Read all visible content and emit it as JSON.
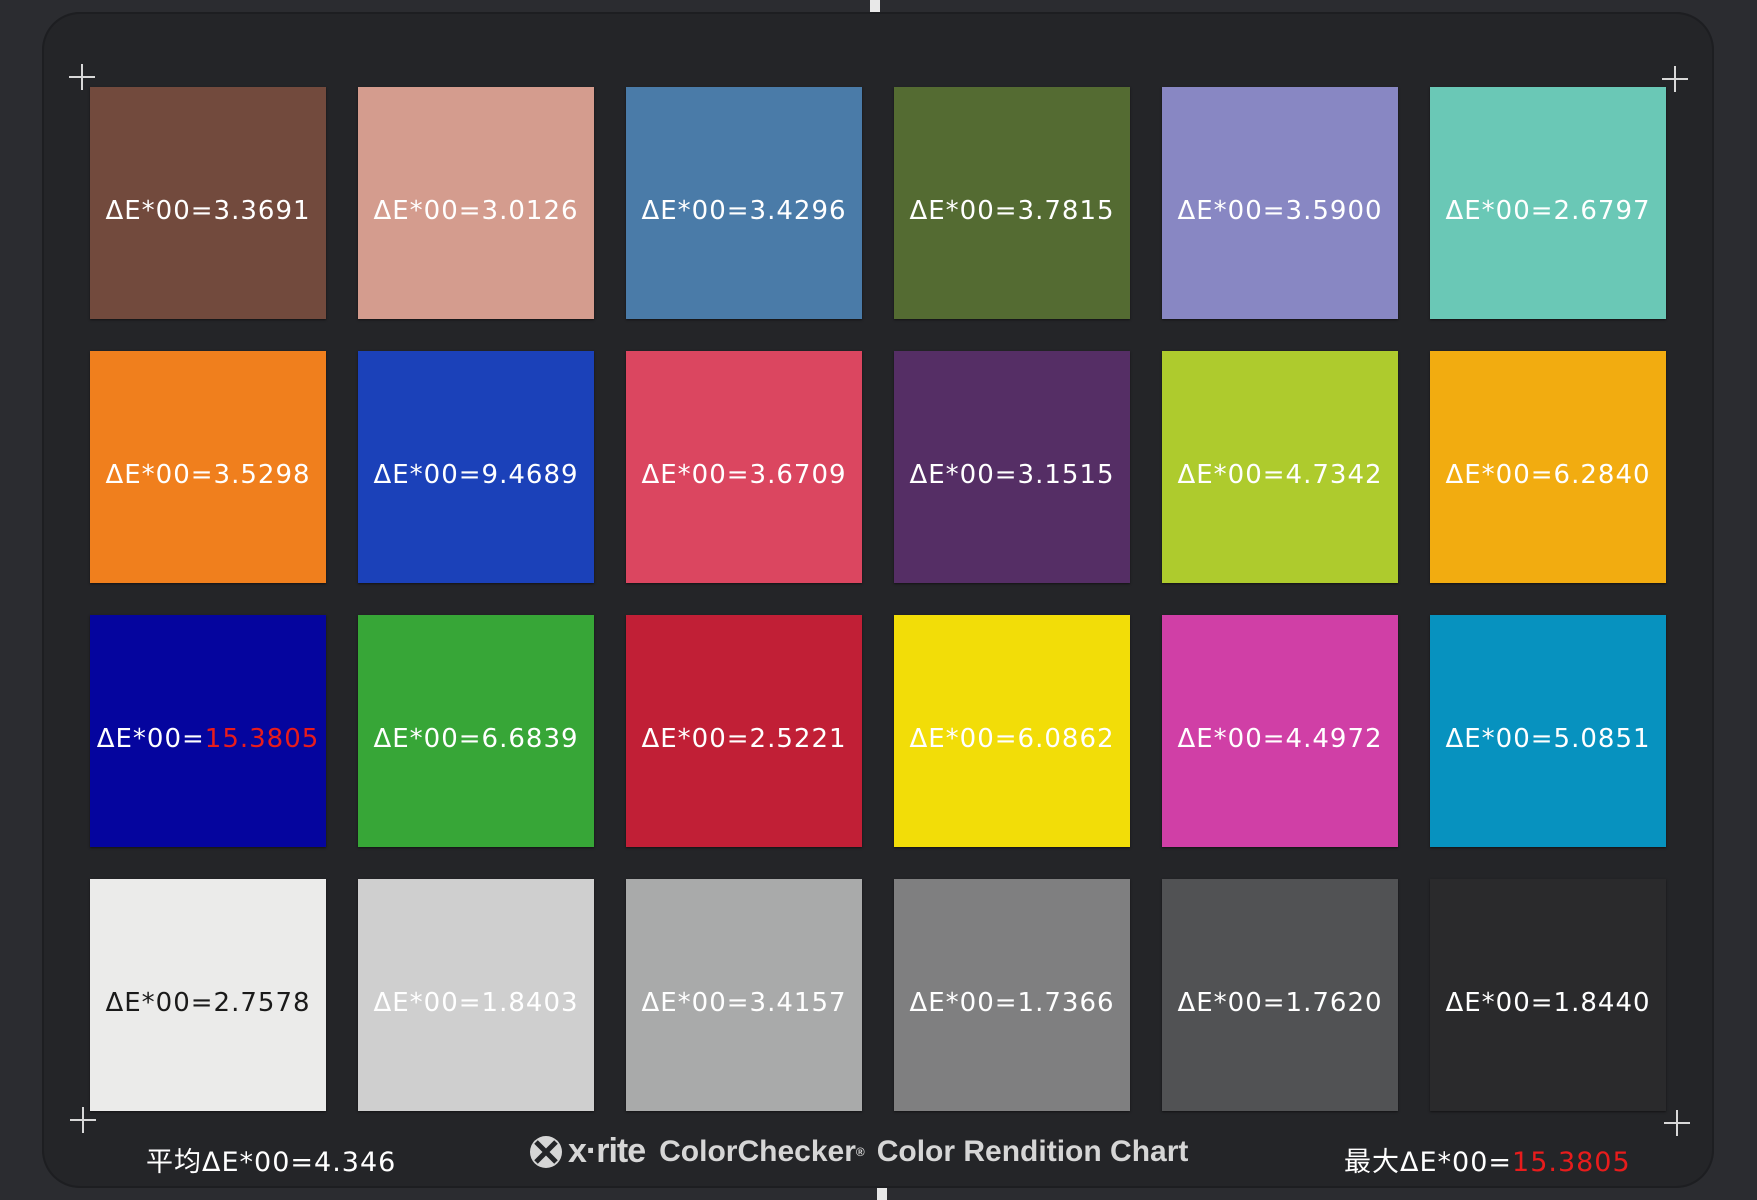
{
  "summary": {
    "average_label": "平均ΔE*00=",
    "average_value": "4.346",
    "max_label": "最大ΔE*00=",
    "max_value": "15.3805",
    "max_color": "#e81c1c"
  },
  "brand": {
    "logo_icon": "x-rite-logo-icon",
    "company": "x·rite",
    "product": "ColorChecker",
    "registered_mark": "®",
    "subtitle": "Color Rendition Chart"
  },
  "patch_prefix": "ΔE*00=",
  "patches": [
    {
      "color": "#724a3d",
      "value": "3.3691"
    },
    {
      "color": "#d49c8e",
      "value": "3.0126"
    },
    {
      "color": "#4a7ba8",
      "value": "3.4296"
    },
    {
      "color": "#546b32",
      "value": "3.7815"
    },
    {
      "color": "#8887c3",
      "value": "3.5900"
    },
    {
      "color": "#6ac8b6",
      "value": "2.6797"
    },
    {
      "color": "#f07f1d",
      "value": "3.5298"
    },
    {
      "color": "#1b41b9",
      "value": "9.4689"
    },
    {
      "color": "#db4660",
      "value": "3.6709"
    },
    {
      "color": "#552e65",
      "value": "3.1515"
    },
    {
      "color": "#aecb2d",
      "value": "4.7342"
    },
    {
      "color": "#f2ac10",
      "value": "6.2840"
    },
    {
      "color": "#05059e",
      "value": "15.3805",
      "highlight": true
    },
    {
      "color": "#37a637",
      "value": "6.6839"
    },
    {
      "color": "#c11f36",
      "value": "2.5221"
    },
    {
      "color": "#f2dd08",
      "value": "6.0862"
    },
    {
      "color": "#d03fa6",
      "value": "4.4972"
    },
    {
      "color": "#0792bf",
      "value": "5.0851"
    },
    {
      "color": "#ebebea",
      "value": "2.7578",
      "dark_text": true
    },
    {
      "color": "#cfcfcf",
      "value": "1.8403"
    },
    {
      "color": "#a9aaaa",
      "value": "3.4157"
    },
    {
      "color": "#7f7f80",
      "value": "1.7366"
    },
    {
      "color": "#515254",
      "value": "1.7620"
    },
    {
      "color": "#2a2a2c",
      "value": "1.8440"
    }
  ]
}
